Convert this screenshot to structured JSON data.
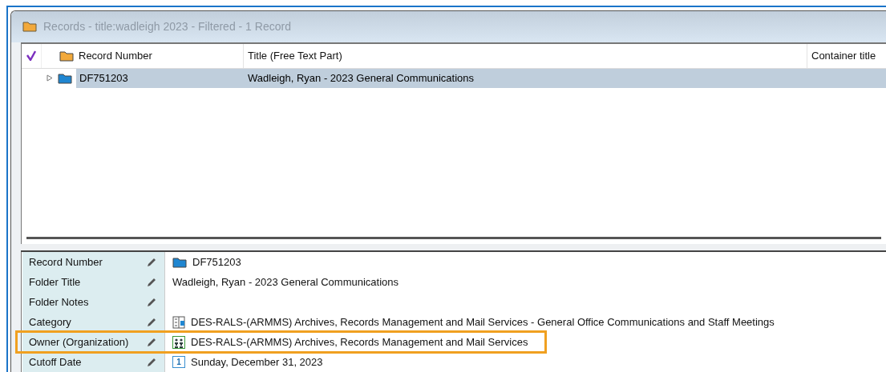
{
  "window": {
    "title": "Records - title:wadleigh 2023 - Filtered - 1 Record"
  },
  "table": {
    "columns": [
      {
        "label": "Record Number",
        "kind": "folder"
      },
      {
        "label": "Title (Free Text Part)"
      },
      {
        "label": "Container title"
      }
    ],
    "rows": [
      {
        "record_number": "DF751203",
        "title": "Wadleigh, Ryan - 2023 General Communications",
        "selected": true,
        "expanded": false
      }
    ]
  },
  "details": [
    {
      "label": "Record Number",
      "value": "DF751203",
      "kind": "folder"
    },
    {
      "label": "Folder Title",
      "value": "Wadleigh, Ryan - 2023 General Communications",
      "kind": "text"
    },
    {
      "label": "Folder Notes",
      "kind": "text"
    },
    {
      "label": "Category",
      "value": "DES-RALS-(ARMMS) Archives, Records Management and Mail Services - General Office Communications and Staff Meetings",
      "kind": "category"
    },
    {
      "label": "Owner (Organization)",
      "value": "DES-RALS-(ARMMS) Archives, Records Management and Mail Services",
      "kind": "organization",
      "highlighted": true
    },
    {
      "label": "Cutoff Date",
      "value": "Sunday, December 31, 2023",
      "kind": "date",
      "icon_text": "1"
    }
  ]
}
